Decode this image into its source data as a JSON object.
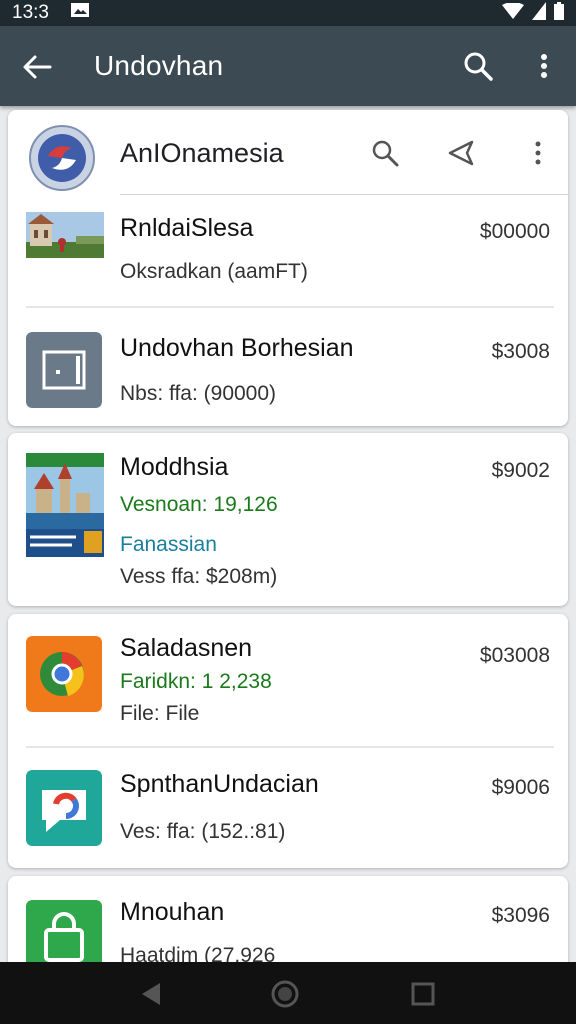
{
  "status": {
    "time": "13:3"
  },
  "appbar": {
    "title": "Undovhan"
  },
  "header": {
    "title": "AnIOnamesia"
  },
  "items": [
    {
      "name": "RnldaiSlesa",
      "price": "$00000",
      "line1": "Oksradkan (aamFT)",
      "icon": "landscape-photo-icon"
    },
    {
      "name": "Undovhan Borhesian",
      "price": "$3008",
      "line1": "Nbs: ffa: (90000)",
      "icon": "app-window-icon"
    },
    {
      "name": "Moddhsia",
      "price": "$9002",
      "line1": "Vesnoan: 19,126",
      "line2": "Fanassian",
      "line3": "Vess ffa: $208m)",
      "icon": "castle-poster-icon"
    },
    {
      "name": "Saladasnen",
      "price": "$03008",
      "line1": "Faridkn: 1 2,238",
      "line2": "File: File",
      "icon": "chrome-logo-icon"
    },
    {
      "name": "SpnthanUndacian",
      "price": "$9006",
      "line1": "Ves: ffa: (152.:81)",
      "icon": "chat-chrome-icon"
    },
    {
      "name": "Mnouhan",
      "price": "$3096",
      "line1": "Haatdim (27.926",
      "icon": "shopping-bag-icon"
    }
  ],
  "colors": {
    "appbar": "#3c4a53",
    "statusbar": "#1f2a30",
    "green": "#1b7a1b",
    "teal": "#1a7f9c"
  }
}
